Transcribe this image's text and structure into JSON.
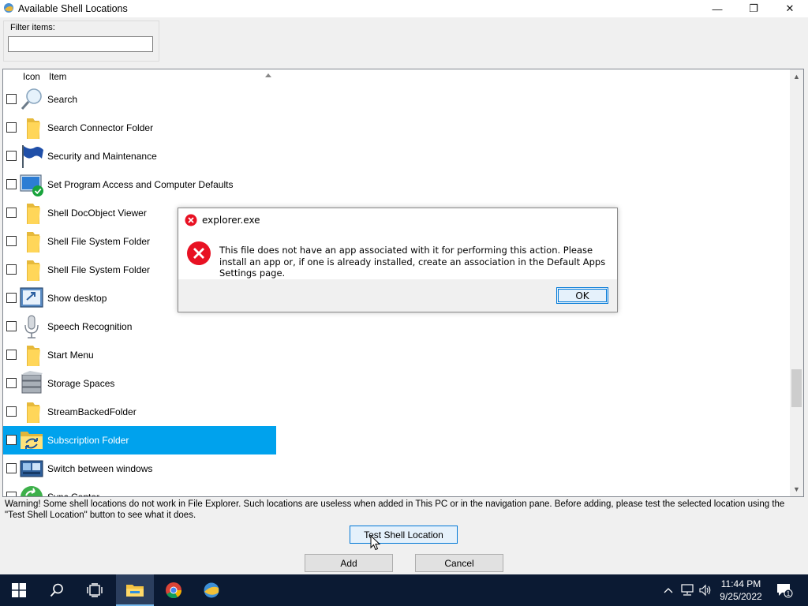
{
  "window": {
    "title": "Available Shell Locations",
    "minimize_glyph": "—",
    "maximize_glyph": "❐",
    "close_glyph": "✕"
  },
  "filter": {
    "label": "Filter items:",
    "value": "",
    "placeholder": ""
  },
  "list": {
    "columns": [
      "Icon",
      "Item"
    ],
    "sort_column": "Item",
    "sort_direction": "ascending",
    "rows": [
      {
        "label": "Search",
        "icon": "magnifier-icon",
        "checked": false,
        "selected": false
      },
      {
        "label": "Search Connector Folder",
        "icon": "folder-icon",
        "checked": false,
        "selected": false
      },
      {
        "label": "Security and Maintenance",
        "icon": "flag-icon",
        "checked": false,
        "selected": false
      },
      {
        "label": "Set Program Access and Computer Defaults",
        "icon": "program-defaults-icon",
        "checked": false,
        "selected": false
      },
      {
        "label": "Shell DocObject Viewer",
        "icon": "folder-icon",
        "checked": false,
        "selected": false
      },
      {
        "label": "Shell File System Folder",
        "icon": "folder-icon",
        "checked": false,
        "selected": false
      },
      {
        "label": "Shell File System Folder",
        "icon": "folder-icon",
        "checked": false,
        "selected": false
      },
      {
        "label": "Show desktop",
        "icon": "show-desktop-icon",
        "checked": false,
        "selected": false
      },
      {
        "label": "Speech Recognition",
        "icon": "microphone-icon",
        "checked": false,
        "selected": false
      },
      {
        "label": "Start Menu",
        "icon": "folder-icon",
        "checked": false,
        "selected": false
      },
      {
        "label": "Storage Spaces",
        "icon": "storage-spaces-icon",
        "checked": false,
        "selected": false
      },
      {
        "label": "StreamBackedFolder",
        "icon": "folder-icon",
        "checked": false,
        "selected": false
      },
      {
        "label": "Subscription Folder",
        "icon": "subscription-folder-icon",
        "checked": false,
        "selected": true
      },
      {
        "label": "Switch between windows",
        "icon": "switch-windows-icon",
        "checked": false,
        "selected": false
      },
      {
        "label": "Sync Center",
        "icon": "sync-center-icon",
        "checked": false,
        "selected": false
      }
    ]
  },
  "warning_text": "Warning! Some shell locations do not work in File Explorer. Such locations are useless when added in This PC or in the navigation pane. Before adding, please test the selected location using the \"Test Shell Location\" button to see what it does.",
  "buttons": {
    "test": "Test Shell Location",
    "add": "Add",
    "cancel": "Cancel"
  },
  "dialog": {
    "title": "explorer.exe",
    "message": "This file does not have an app associated with it for performing this action. Please install an app or, if one is already installed, create an association in the Default Apps Settings page.",
    "ok": "OK",
    "icon": "error-icon"
  },
  "taskbar": {
    "apps": [
      "start-icon",
      "search-icon",
      "task-view-icon",
      "file-explorer-icon",
      "chrome-icon",
      "winaero-tweaker-icon"
    ],
    "active_app": "file-explorer-icon",
    "time": "11:44 PM",
    "date": "9/25/2022",
    "notification_count": "1"
  },
  "colors": {
    "selection": "#00a2ed",
    "taskbar": "#0b1a33",
    "error_red": "#e81123",
    "accent": "#0078d7"
  }
}
